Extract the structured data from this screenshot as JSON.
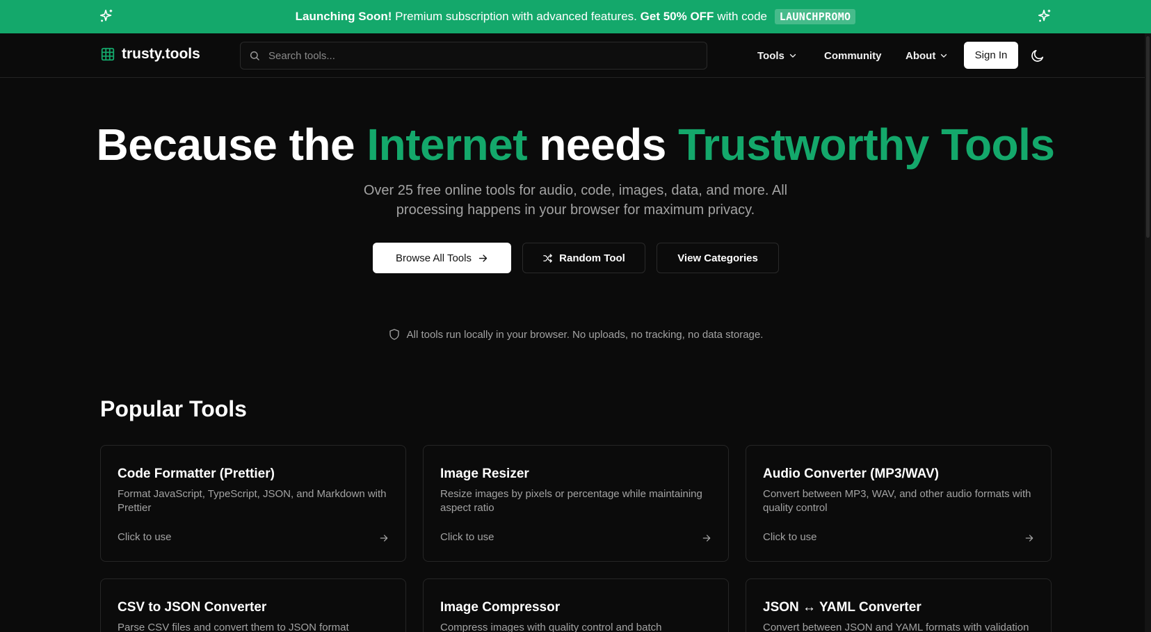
{
  "banner": {
    "lead": "Launching Soon!",
    "text": "Premium subscription with advanced features.",
    "offer": "Get 50% OFF",
    "with_code": "with code",
    "code": "LAUNCHPROMO",
    "icon": "sparkles-icon"
  },
  "header": {
    "logo_text": "trusty.tools",
    "logo_icon": "grid-icon",
    "search_placeholder": "Search tools...",
    "nav": {
      "tools": "Tools",
      "community": "Community",
      "about": "About"
    },
    "sign_in": "Sign In",
    "theme_icon": "moon-icon"
  },
  "hero": {
    "title_part1": "Because the ",
    "title_green1": "Internet",
    "title_part2": " needs ",
    "title_green2": "Trustworthy Tools",
    "subtitle": "Over 25 free online tools for audio, code, images, data, and more. All processing happens in your browser for maximum privacy.",
    "browse_label": "Browse All Tools",
    "random_label": "Random Tool",
    "categories_label": "View Categories",
    "privacy_note": "All tools run locally in your browser. No uploads, no tracking, no data storage."
  },
  "popular": {
    "title": "Popular Tools",
    "cta": "Click to use",
    "tools": [
      {
        "title": "Code Formatter (Prettier)",
        "desc": "Format JavaScript, TypeScript, JSON, and Markdown with Prettier"
      },
      {
        "title": "Image Resizer",
        "desc": "Resize images by pixels or percentage while maintaining aspect ratio"
      },
      {
        "title": "Audio Converter (MP3/WAV)",
        "desc": "Convert between MP3, WAV, and other audio formats with quality control"
      },
      {
        "title": "CSV to JSON Converter",
        "desc": "Parse CSV files and convert them to JSON format"
      },
      {
        "title": "Image Compressor",
        "desc": "Compress images with quality control and batch"
      },
      {
        "title": "JSON ↔ YAML Converter",
        "desc": "Convert between JSON and YAML formats with validation"
      }
    ]
  },
  "colors": {
    "brand_green": "#14a86b",
    "background": "#0b0b0b"
  }
}
